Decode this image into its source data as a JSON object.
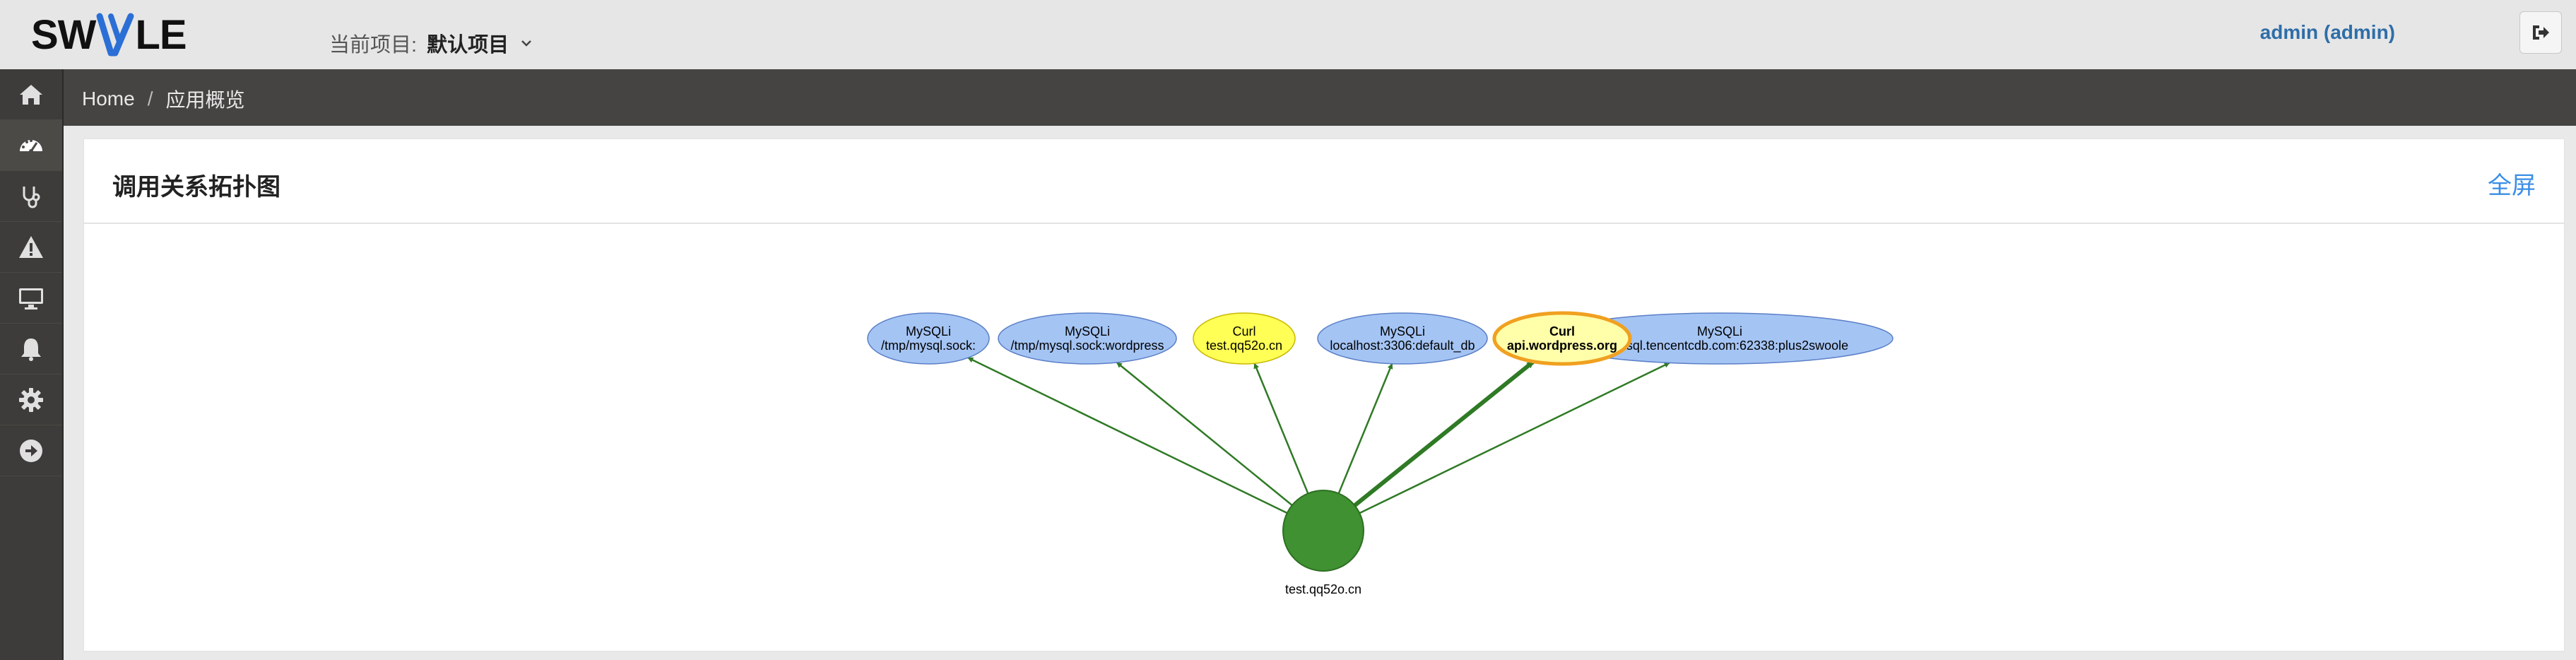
{
  "header": {
    "logo_text_left": "SW",
    "logo_text_right": "LE",
    "project_label": "当前项目:",
    "project_name": "默认项目",
    "user": "admin (admin)"
  },
  "sidebar": {
    "items": [
      {
        "icon": "home-icon"
      },
      {
        "icon": "dashboard-icon",
        "active": true
      },
      {
        "icon": "stethoscope-icon"
      },
      {
        "icon": "warning-icon"
      },
      {
        "icon": "monitor-icon"
      },
      {
        "icon": "bell-icon"
      },
      {
        "icon": "gear-icon"
      },
      {
        "icon": "arrow-circle-right-icon"
      }
    ]
  },
  "breadcrumb": {
    "home": "Home",
    "separator": "/",
    "current": "应用概览"
  },
  "panel": {
    "title": "调用关系拓扑图",
    "fullscreen_label": "全屏"
  },
  "graph": {
    "root": {
      "label": "test.qq52o.cn",
      "color": "#3f9132"
    },
    "edge_color": "#2f7a25",
    "targets": [
      {
        "type": "MySQLi",
        "target": "/tmp/mysql.sock:",
        "color": "#a4c4f4",
        "highlight": false
      },
      {
        "type": "MySQLi",
        "target": "/tmp/mysql.sock:wordpress",
        "color": "#a4c4f4",
        "highlight": false
      },
      {
        "type": "Curl",
        "target": "test.qq52o.cn",
        "color": "#ffff55",
        "highlight": false
      },
      {
        "type": "MySQLi",
        "target": "localhost:3306:default_db",
        "color": "#a4c4f4",
        "highlight": false
      },
      {
        "type": "MySQLi",
        "target": "...344.sql.tencentcdb.com:62338:plus2swoole",
        "color": "#a4c4f4",
        "highlight": false
      },
      {
        "type": "Curl",
        "target": "api.wordpress.org",
        "color": "#ffffaa",
        "highlight": true
      }
    ]
  }
}
